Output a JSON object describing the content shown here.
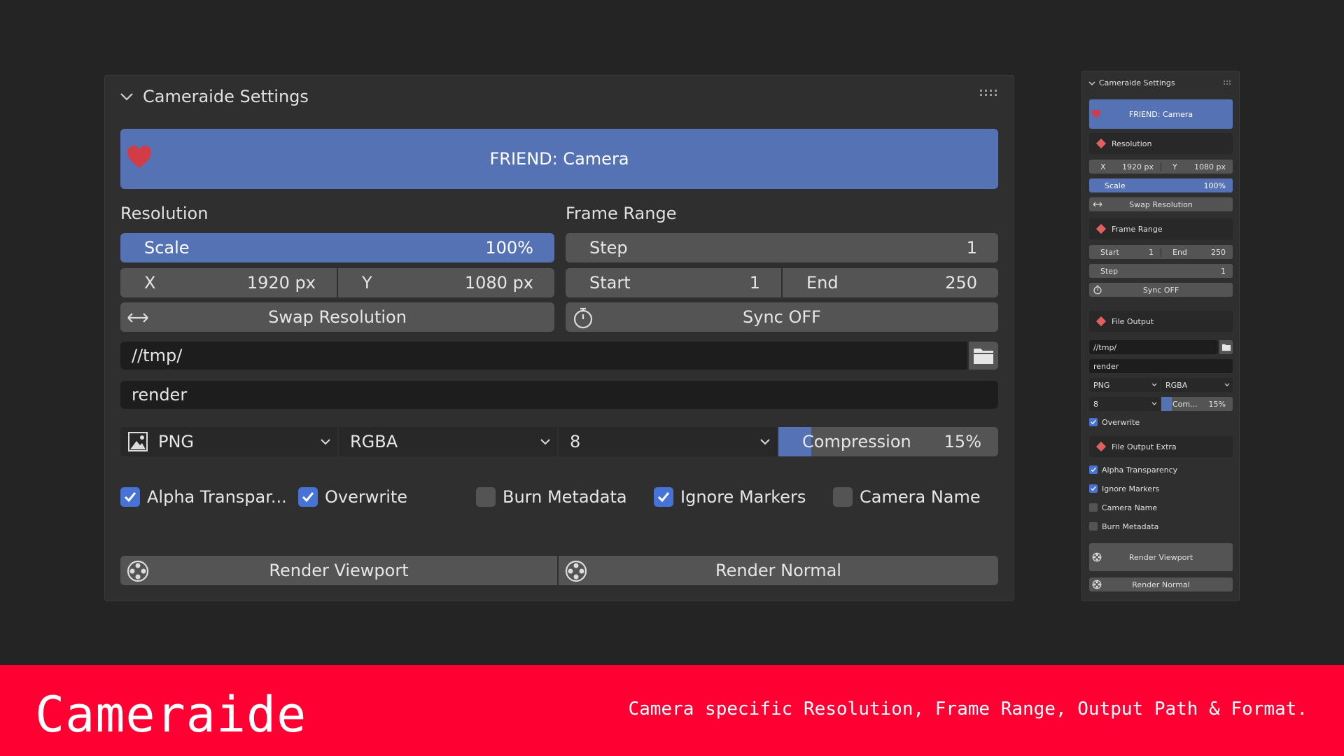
{
  "panel": {
    "title": "Cameraide Settings",
    "friend_label": "FRIEND: Camera",
    "resolution": {
      "label": "Resolution",
      "scale_label": "Scale",
      "scale_value": "100%",
      "x_label": "X",
      "x_value": "1920 px",
      "y_label": "Y",
      "y_value": "1080 px",
      "swap_label": "Swap Resolution"
    },
    "frame_range": {
      "label": "Frame Range",
      "step_label": "Step",
      "step_value": "1",
      "start_label": "Start",
      "start_value": "1",
      "end_label": "End",
      "end_value": "250",
      "sync_label": "Sync OFF"
    },
    "output": {
      "path": "//tmp/",
      "filename": "render",
      "format": "PNG",
      "color": "RGBA",
      "depth": "8",
      "compression_label": "Compression",
      "compression_value": "15%",
      "compression_fraction": 0.15
    },
    "checkboxes": [
      {
        "label": "Alpha Transpar...",
        "checked": true
      },
      {
        "label": "Overwrite",
        "checked": true
      },
      {
        "label": "Burn Metadata",
        "checked": false
      },
      {
        "label": "Ignore Markers",
        "checked": true
      },
      {
        "label": "Camera Name",
        "checked": false
      }
    ],
    "render_viewport": "Render Viewport",
    "render_normal": "Render Normal"
  },
  "small_panel": {
    "title": "Cameraide Settings",
    "friend_label": "FRIEND: Camera",
    "resolution_label": "Resolution",
    "x_label": "X",
    "x_value": "1920 px",
    "y_label": "Y",
    "y_value": "1080 px",
    "scale_label": "Scale",
    "scale_value": "100%",
    "swap_label": "Swap Resolution",
    "frame_range_label": "Frame Range",
    "start_label": "Start",
    "start_value": "1",
    "end_label": "End",
    "end_value": "250",
    "step_label": "Step",
    "step_value": "1",
    "sync_label": "Sync OFF",
    "file_output_label": "File Output",
    "path": "//tmp/",
    "filename": "render",
    "format": "PNG",
    "color": "RGBA",
    "depth": "8",
    "compression_label": "Com...",
    "compression_value": "15%",
    "overwrite_label": "Overwrite",
    "file_output_extra_label": "File Output Extra",
    "extra_checkboxes": [
      {
        "label": "Alpha Transparency",
        "checked": true
      },
      {
        "label": "Ignore Markers",
        "checked": true
      },
      {
        "label": "Camera Name",
        "checked": false
      },
      {
        "label": "Burn Metadata",
        "checked": false
      }
    ],
    "render_viewport": "Render Viewport",
    "render_normal": "Render Normal"
  },
  "banner": {
    "brand": "Cameraide",
    "tagline": "Camera specific Resolution, Frame Range, Output Path & Format."
  },
  "colors": {
    "accent_blue": "#5472b4",
    "checkbox_blue": "#4772d6",
    "banner_red": "#ff0033",
    "heart_red": "#d23c46"
  }
}
